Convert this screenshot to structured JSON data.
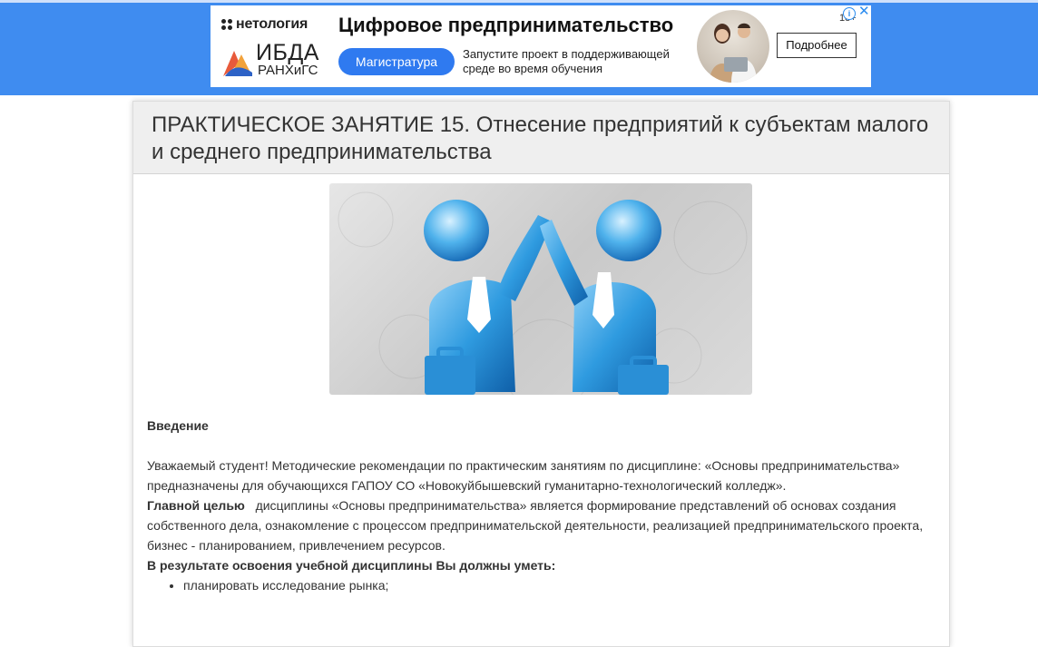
{
  "ad": {
    "brand": "нетология",
    "logo_main": "ИБДА",
    "logo_sub": "РАНХиГС",
    "title": "Цифровое предпринимательство",
    "pill": "Магистратура",
    "description": "Запустите проект в поддерживающей среде во время обучения",
    "button": "Подробнее",
    "age": "18+",
    "info_glyph": "i",
    "close_glyph": "✕",
    "colors": {
      "band": "#3f8cf0",
      "pill": "#2f7af0",
      "accent": "#2a8cf0"
    }
  },
  "page": {
    "title": "ПРАКТИЧЕСКОЕ ЗАНЯТИЕ 15. Отнесение предприятий к субъектам малого и среднего предпринимательства",
    "hero_icon": "business-people-high-five-image"
  },
  "content": {
    "intro_heading": "Введение",
    "intro_text": "Уважаемый студент! Методические рекомендации по практическим занятиям по дисциплине: «Основы предпринимательства» предназначены для обучающихся ГАПОУ СО «Новокуйбышевский гуманитарно-технологический колледж».",
    "goal_label": "Главной целью",
    "goal_text": "дисциплины «Основы предпринимательства» является формирование представлений об основах создания собственного дела, ознакомление с процессом предпринимательской деятельности, реализацией предпринимательского проекта, бизнес - планированием, привлечением ресурсов.",
    "skills_heading": "В результате освоения учебной дисциплины Вы должны уметь:",
    "skills": [
      "планировать исследование рынка;"
    ]
  }
}
